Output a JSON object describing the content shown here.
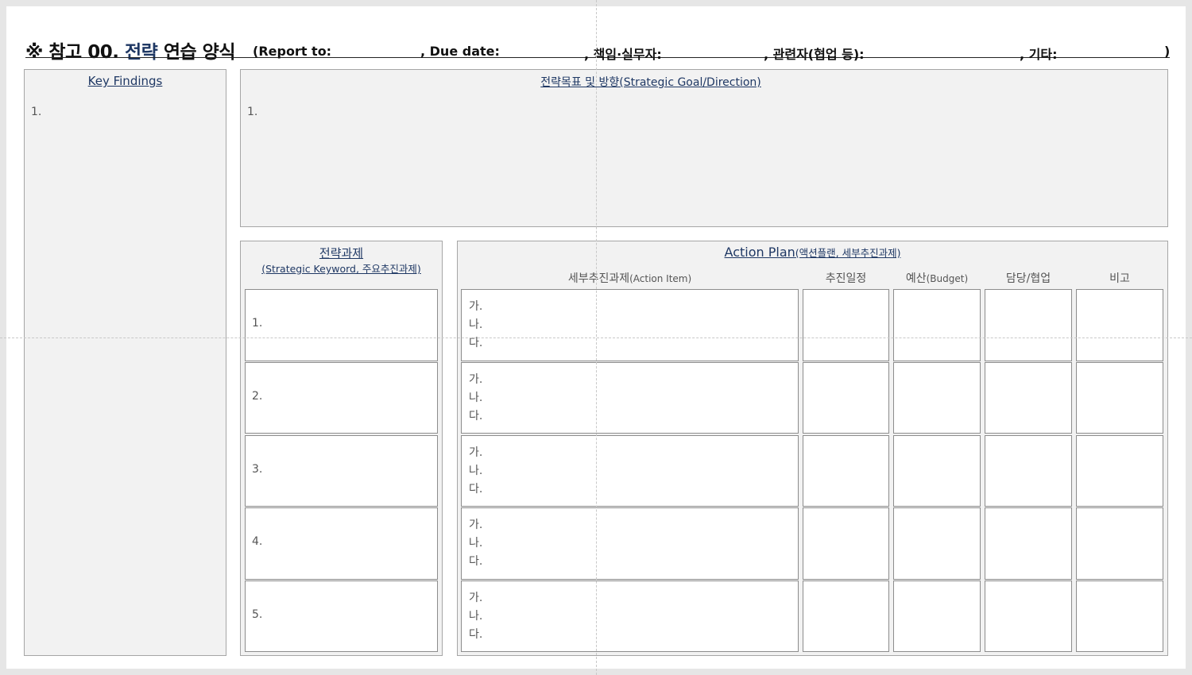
{
  "title": {
    "mark": "※",
    "prefix": "참고 00.",
    "highlight": "전략",
    "suffix": "연습 양식",
    "fields": [
      "(Report to:",
      ", Due date:",
      ", 책임·실무자:",
      ", 관련자(협업 등):",
      ", 기타:",
      ")"
    ]
  },
  "key_findings": {
    "heading": "Key Findings",
    "item": "1."
  },
  "goal": {
    "heading": "전략목표 및 방향(Strategic Goal/Direction)",
    "item": "1."
  },
  "tasks": {
    "heading_line1": "전략과제",
    "heading_line2": "(Strategic Keyword, 주요추진과제)",
    "items": [
      "1.",
      "2.",
      "3.",
      "4.",
      "5."
    ]
  },
  "action_plan": {
    "heading_main": "Action Plan",
    "heading_sub": "(액션플랜, 세부추진과제)",
    "columns": {
      "item_ko": "세부추진과제",
      "item_en": "(Action Item)",
      "schedule": "추진일정",
      "budget_ko": "예산",
      "budget_en": "(Budget)",
      "owner": "담당/협업",
      "note": "비고"
    },
    "subitems": [
      "가.",
      "나.",
      "다."
    ]
  }
}
